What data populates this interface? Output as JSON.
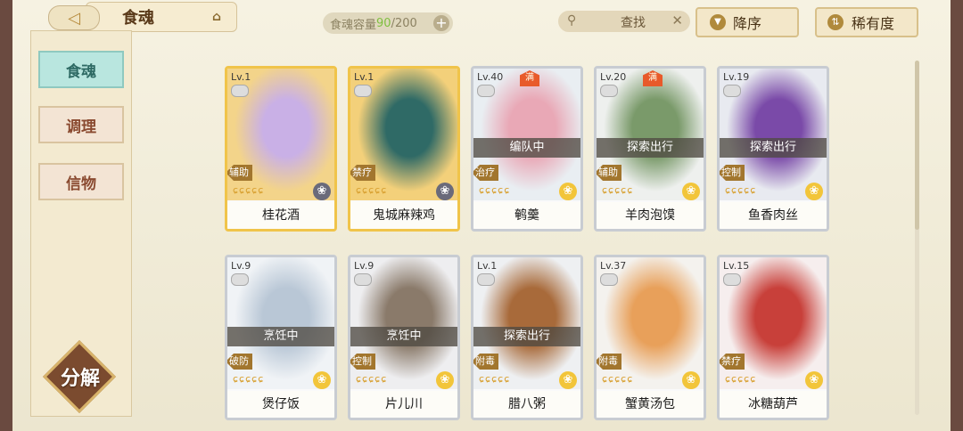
{
  "header": {
    "back_icon": "back-arrow-icon",
    "title": "食魂",
    "home_icon": "home-icon",
    "capacity_label": "食魂容量",
    "capacity_current": "90",
    "capacity_max": "/200",
    "capacity_plus": "+",
    "search_label": "查找",
    "search_clear": "✕",
    "sort_label": "降序",
    "rarity_label": "稀有度"
  },
  "sidebar": {
    "items": [
      {
        "label": "食魂",
        "active": true
      },
      {
        "label": "调理",
        "active": false
      },
      {
        "label": "信物",
        "active": false
      }
    ],
    "decompose_label": "分解"
  },
  "cards": [
    {
      "level": "Lv.1",
      "name": "桂花酒",
      "role": "辅助",
      "status": "",
      "full": false,
      "gold": true,
      "dark_star": true,
      "art": [
        "#f3d48a",
        "#c9b0e6"
      ]
    },
    {
      "level": "Lv.1",
      "name": "鬼城麻辣鸡",
      "role": "禁疗",
      "status": "",
      "full": false,
      "gold": true,
      "dark_star": true,
      "art": [
        "#f3d07a",
        "#2f6a66"
      ]
    },
    {
      "level": "Lv.40",
      "name": "鹌羹",
      "role": "治疗",
      "status": "编队中",
      "full": true,
      "full_label": "满",
      "gold": false,
      "dark_star": false,
      "art": [
        "#e9eef2",
        "#e9a8b6"
      ]
    },
    {
      "level": "Lv.20",
      "name": "羊肉泡馍",
      "role": "辅助",
      "status": "探索出行",
      "full": true,
      "full_label": "满",
      "gold": false,
      "dark_star": false,
      "art": [
        "#eef0ee",
        "#7a9a6a"
      ]
    },
    {
      "level": "Lv.19",
      "name": "鱼香肉丝",
      "role": "控制",
      "status": "探索出行",
      "full": false,
      "gold": false,
      "dark_star": false,
      "art": [
        "#e8eaf0",
        "#7a4aa8"
      ]
    },
    {
      "level": "Lv.9",
      "name": "煲仔饭",
      "role": "破防",
      "status": "烹饪中",
      "full": false,
      "gold": false,
      "dark_star": false,
      "art": [
        "#f0f3f6",
        "#b9c7d6"
      ]
    },
    {
      "level": "Lv.9",
      "name": "片儿川",
      "role": "控制",
      "status": "烹饪中",
      "full": false,
      "gold": false,
      "dark_star": false,
      "art": [
        "#eeeef0",
        "#8a7a6a"
      ]
    },
    {
      "level": "Lv.1",
      "name": "腊八粥",
      "role": "附毒",
      "status": "探索出行",
      "full": false,
      "gold": false,
      "dark_star": false,
      "art": [
        "#eef0f2",
        "#a86a3a"
      ]
    },
    {
      "level": "Lv.37",
      "name": "蟹黄汤包",
      "role": "附毒",
      "status": "",
      "full": false,
      "gold": false,
      "dark_star": false,
      "art": [
        "#f4f2ee",
        "#e8a05a"
      ]
    },
    {
      "level": "Lv.15",
      "name": "冰糖葫芦",
      "role": "禁疗",
      "status": "",
      "full": false,
      "gold": false,
      "dark_star": false,
      "art": [
        "#f6eeee",
        "#c8403a"
      ]
    }
  ],
  "card_flames": "ɕɕɕɕɕ",
  "card_star_glyph": "❀"
}
